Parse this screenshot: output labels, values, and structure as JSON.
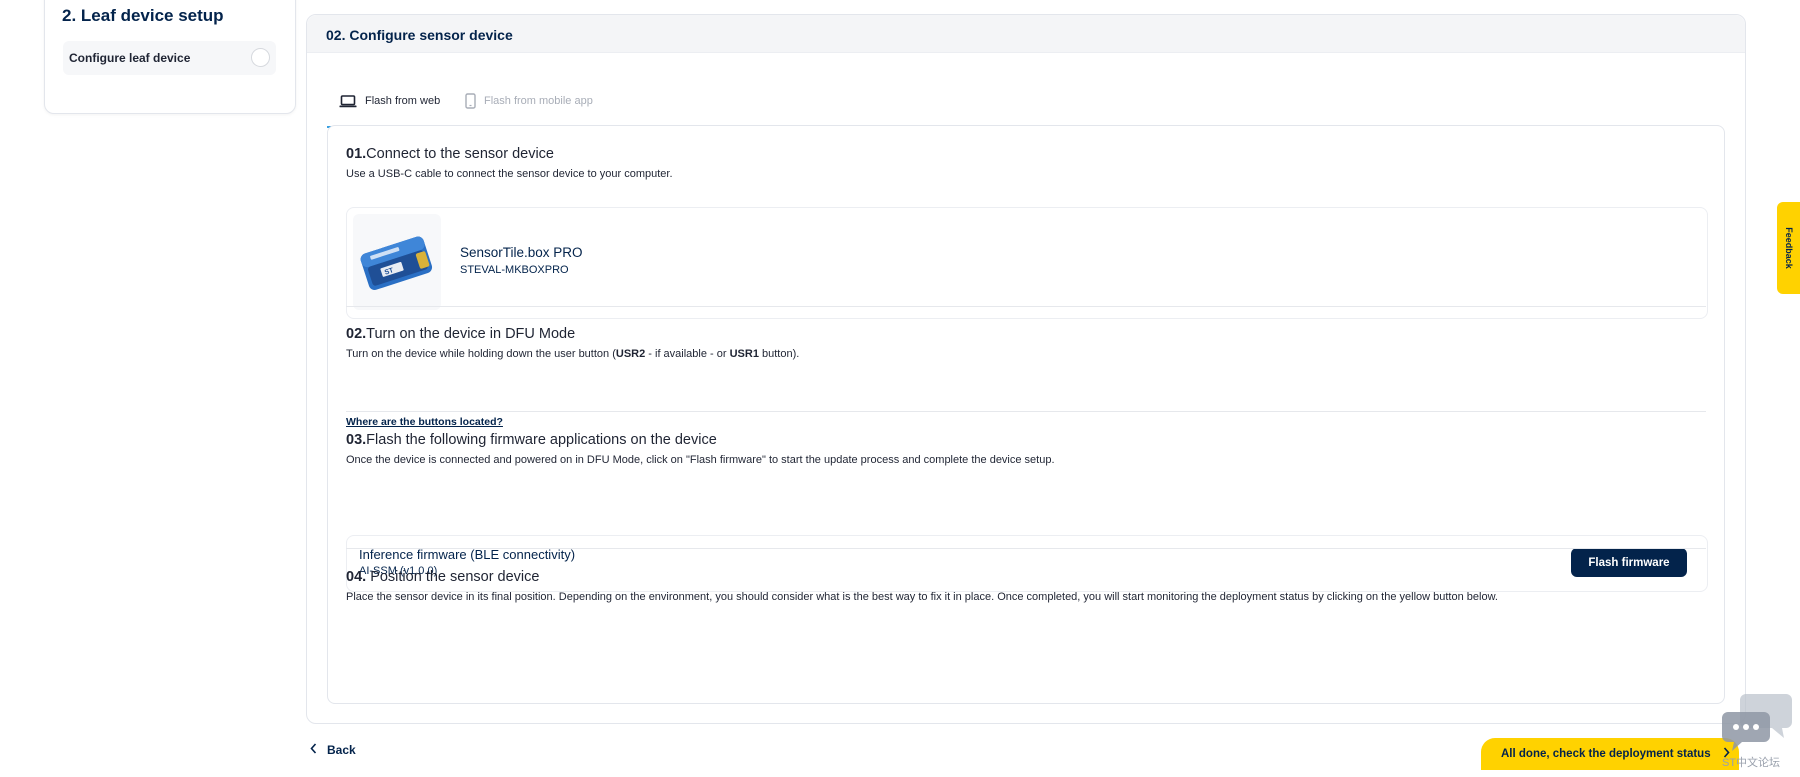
{
  "sidebar": {
    "title": "2. Leaf device setup",
    "items": [
      {
        "label": "Configure leaf device"
      }
    ]
  },
  "main": {
    "title": "02. Configure sensor device",
    "tabs": [
      {
        "label": "Flash from web",
        "icon": "laptop-icon",
        "active": true
      },
      {
        "label": "Flash from mobile app",
        "icon": "smartphone-icon",
        "active": false
      }
    ],
    "steps": [
      {
        "number": "01.",
        "title": "Connect to the sensor device",
        "description": "Use a USB-C cable to connect the sensor device to your computer.",
        "device": {
          "name": "SensorTile.box PRO",
          "code": "STEVAL-MKBOXPRO"
        }
      },
      {
        "number": "02.",
        "title": "Turn on the device in DFU Mode",
        "desc_pre": "Turn on the device while holding down the user button (",
        "desc_b1": "USR2",
        "desc_mid": " - if available - or ",
        "desc_b2": "USR1",
        "desc_post": " button).",
        "link": "Where are the buttons located?"
      },
      {
        "number": "03.",
        "title": "Flash the following firmware applications on the device",
        "description": "Once the device is connected and powered on in DFU Mode, click on \"Flash firmware\" to start the update process and complete the device setup.",
        "firmware": {
          "name": "Inference firmware (BLE connectivity)",
          "version": "AI-SSM (v1.0.0)",
          "button": "Flash firmware"
        }
      },
      {
        "number": "04.",
        "title": " Position the sensor device",
        "description": "Place the sensor device in its final position. Depending on the environment, you should consider what is the best way to fix it in place. Once completed, you will start monitoring the deployment status by clicking on the yellow button below."
      }
    ]
  },
  "footer": {
    "back": "Back",
    "done": "All done, check the deployment status"
  },
  "feedback": "Feedback",
  "watermark": "ST中文论坛",
  "colors": {
    "brand_navy": "#03234b",
    "accent_yellow": "#ffd200",
    "tab_underline": "#3aa0e0"
  }
}
